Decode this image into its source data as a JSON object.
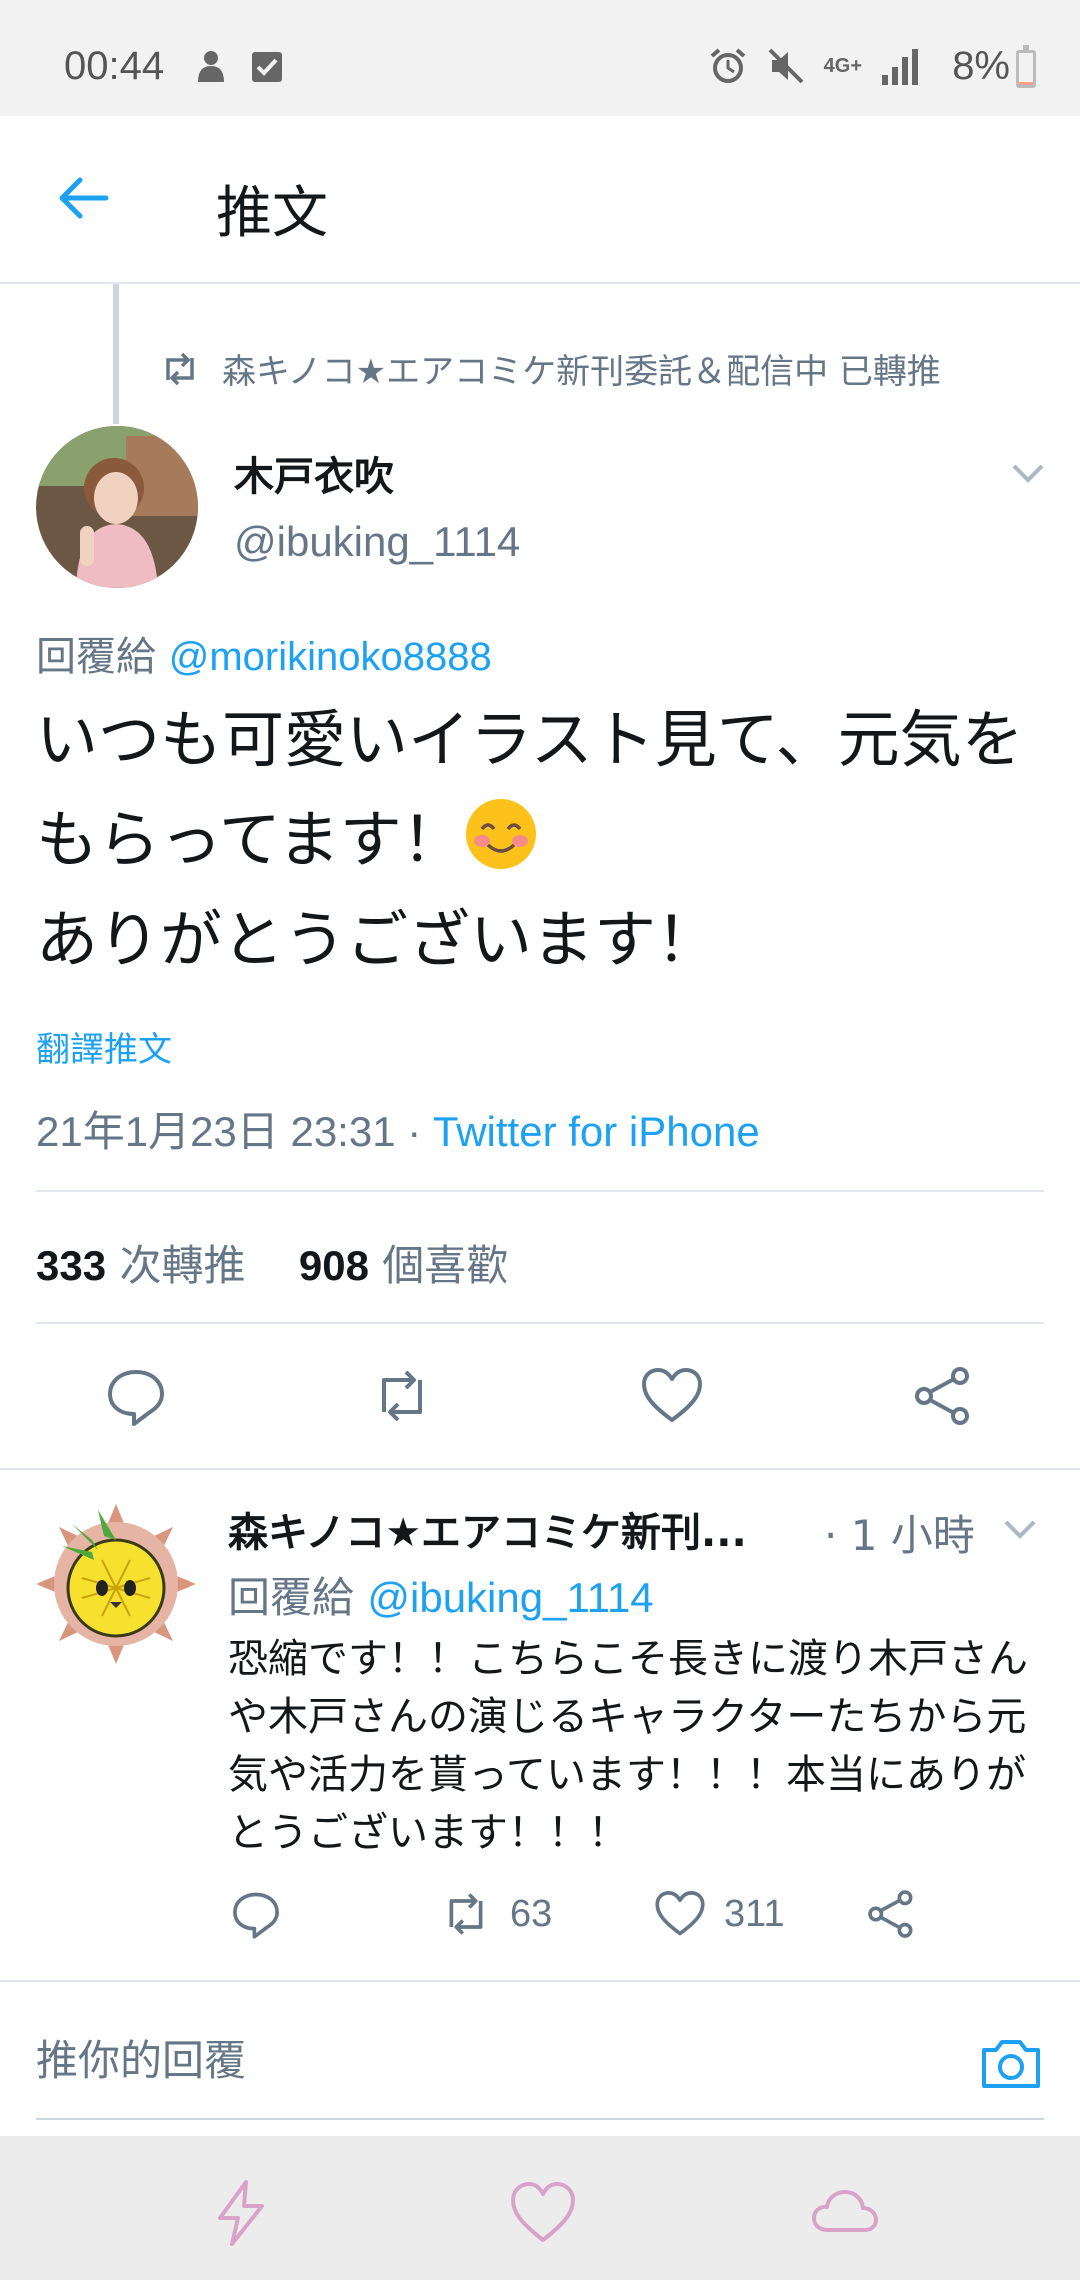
{
  "status_bar": {
    "time": "00:44",
    "battery": "8%",
    "battery_level": 0.08,
    "network": "4G+",
    "icons": [
      "notification-icon",
      "checkbox-icon",
      "alarm-icon",
      "mute-icon",
      "network-icon",
      "signal-icon",
      "battery-icon"
    ]
  },
  "header": {
    "title": "推文",
    "back_icon": "back-arrow-icon"
  },
  "retweet_context": {
    "text": "森キノコ★エアコミケ新刊委託＆配信中 已轉推",
    "icon": "retweet-icon"
  },
  "tweet": {
    "author_name": "木戸衣吹",
    "author_handle": "@ibuking_1114",
    "reply_label": "回覆給",
    "reply_mention": "@morikinoko8888",
    "text_line1": "いつも可愛いイラスト見て、元気を",
    "text_line2": "もらってます！",
    "text_line3": "ありがとうございます！",
    "emoji": "smiling-face-icon",
    "translate_label": "翻譯推文",
    "timestamp": "21年1月23日 23:31 · ",
    "client": "Twitter for iPhone",
    "retweets_count": "333",
    "retweets_label": "次轉推",
    "likes_count": "908",
    "likes_label": "個喜歡"
  },
  "reply": {
    "author_name": "森キノコ★エアコミケ新刊...",
    "time": "· 1 小時",
    "reply_label": "回覆給",
    "reply_mention": "@ibuking_1114",
    "text": "恐縮です！！こちらこそ長きに渡り木戸さんや木戸さんの演じるキャラクターたちから元気や活力を貰っています！！！本当にありがとうございます！！！",
    "retweet_count": "63",
    "like_count": "311"
  },
  "composer": {
    "placeholder": "推你的回覆"
  },
  "colors": {
    "accent": "#1da1f2",
    "secondary_text": "#657786",
    "divider": "#e1e8ed",
    "nav_icon": "#d9a3c9"
  }
}
